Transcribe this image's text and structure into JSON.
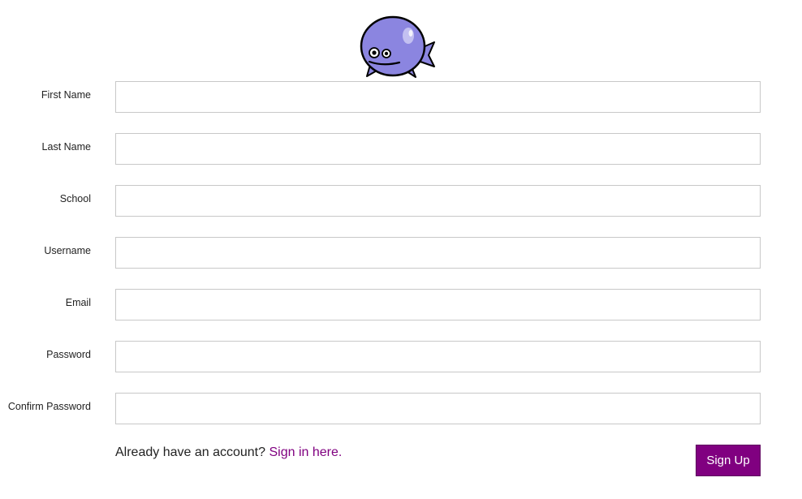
{
  "mascot": {
    "icon": "purple-fish-mascot-icon"
  },
  "form": {
    "fields": [
      {
        "label": "First Name",
        "value": "",
        "placeholder": ""
      },
      {
        "label": "Last Name",
        "value": "",
        "placeholder": ""
      },
      {
        "label": "School",
        "value": "",
        "placeholder": ""
      },
      {
        "label": "Username",
        "value": "",
        "placeholder": ""
      },
      {
        "label": "Email",
        "value": "",
        "placeholder": ""
      },
      {
        "label": "Password",
        "value": "",
        "placeholder": ""
      },
      {
        "label": "Confirm Password",
        "value": "",
        "placeholder": ""
      }
    ],
    "signin_prompt": "Already have an account?",
    "signin_link": "Sign in here.",
    "submit_label": "Sign Up"
  },
  "colors": {
    "accent": "#800080",
    "mascot_body": "#8b85e0",
    "input_border": "#c8c8c8"
  }
}
